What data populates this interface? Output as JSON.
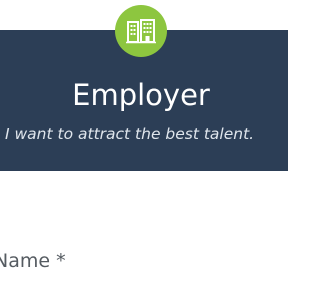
{
  "header": {
    "icon": "office-buildings-icon",
    "title": "Employer",
    "subtitle": "I want to attract the best talent."
  },
  "form": {
    "name_label": "Name *"
  },
  "colors": {
    "banner": "#2c3e56",
    "badge": "#8dc63f",
    "title_text": "#ffffff",
    "label_text": "#555b61"
  }
}
